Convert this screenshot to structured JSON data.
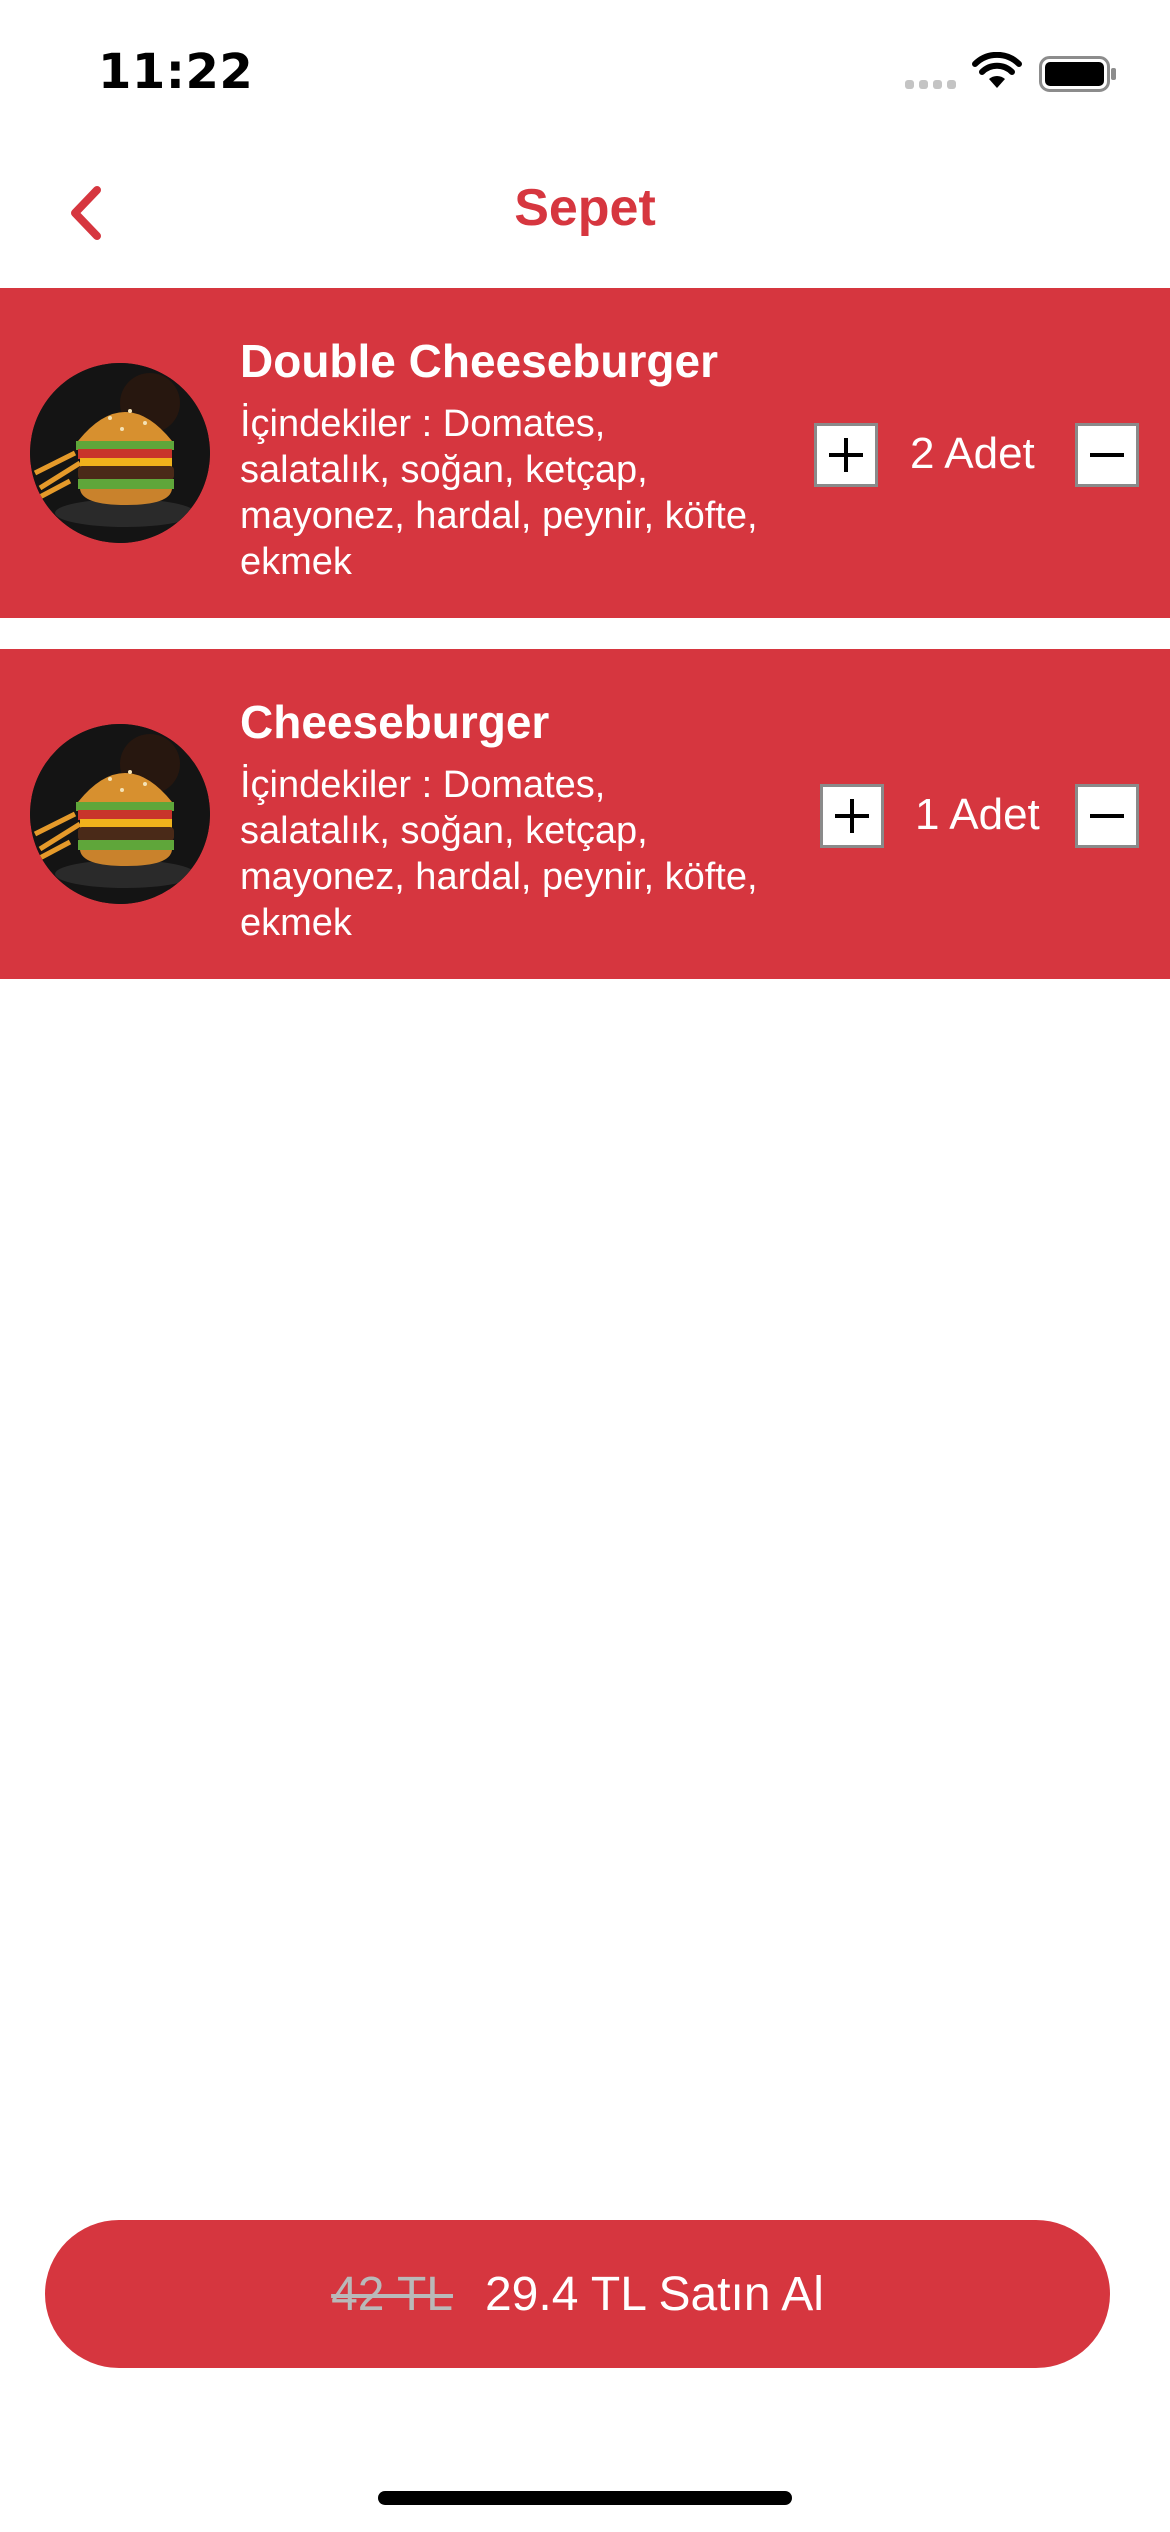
{
  "status_bar": {
    "time": "11:22"
  },
  "nav": {
    "title": "Sepet",
    "back_icon": "chevron-left-icon"
  },
  "colors": {
    "accent": "#d6363f",
    "white": "#ffffff"
  },
  "cart": {
    "items": [
      {
        "name": "Double Cheeseburger",
        "description": "İçindekiler : Domates, salatalık, soğan, ketçap, mayonez, hardal, peynir, köfte, ekmek",
        "quantity_label": "2 Adet",
        "quantity": 2
      },
      {
        "name": "Cheeseburger",
        "description": "İçindekiler : Domates, salatalık, soğan, ketçap, mayonez, hardal, peynir, köfte, ekmek",
        "quantity_label": "1 Adet",
        "quantity": 1
      }
    ]
  },
  "checkout": {
    "old_price": "42 TL",
    "label": "29.4 TL Satın Al"
  }
}
